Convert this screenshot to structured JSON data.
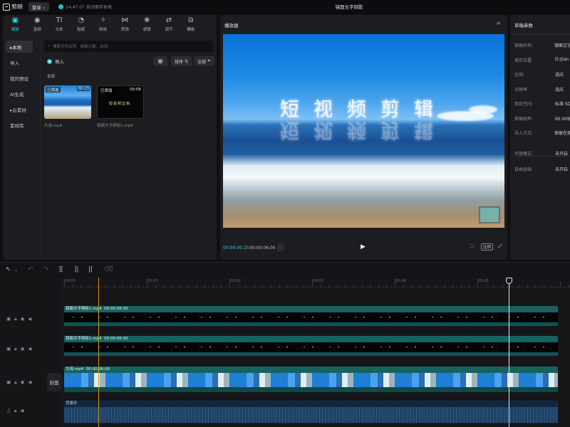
{
  "app": {
    "name": "剪映",
    "menu_label": "菜单",
    "save_status": "14:47:07 自动保存本地",
    "project_title": "镜面文字倒影"
  },
  "toolbar": {
    "tabs": [
      {
        "label": "媒体",
        "icon": "media-icon",
        "glyph": "▣"
      },
      {
        "label": "音频",
        "icon": "audio-icon",
        "glyph": "◉"
      },
      {
        "label": "文本",
        "icon": "text-icon",
        "glyph": "TI"
      },
      {
        "label": "贴纸",
        "icon": "sticker-icon",
        "glyph": "◔"
      },
      {
        "label": "特效",
        "icon": "effects-icon",
        "glyph": "✧"
      },
      {
        "label": "转场",
        "icon": "transition-icon",
        "glyph": "⋈"
      },
      {
        "label": "滤镜",
        "icon": "filter-icon",
        "glyph": "❀"
      },
      {
        "label": "调节",
        "icon": "adjust-icon",
        "glyph": "⇄"
      },
      {
        "label": "模板",
        "icon": "template-icon",
        "glyph": "⧉"
      }
    ]
  },
  "sidebar": {
    "items": [
      {
        "label": "▸本地"
      },
      {
        "label": "导入"
      },
      {
        "label": "我的预设"
      },
      {
        "label": "AI生成"
      },
      {
        "label": "▸云素材"
      },
      {
        "label": "素材库"
      }
    ]
  },
  "media_panel": {
    "search_placeholder": "搜索文件名称、画面元素、台词",
    "import_label": "导入",
    "sort_label": "排序",
    "filter_label": "全部",
    "all_label": "全部",
    "items": [
      {
        "name": "大海.mp4",
        "badge": "已添加",
        "duration": "00:23"
      },
      {
        "name": "镜面文字倒影1.mp4",
        "badge": "已添加",
        "duration": "00:06"
      }
    ],
    "dark_thumb_text": "短视频剪辑"
  },
  "player": {
    "title": "播放器",
    "overlay_text": "短视频剪辑",
    "time_current": "00:00:00:25",
    "time_total": "00:00:06:00",
    "ratio_label": "比例"
  },
  "params": {
    "title": "草稿参数",
    "rows": [
      {
        "k": "草稿名称:",
        "v": "镜面文字"
      },
      {
        "k": "保存位置:",
        "v": "D:/Jian"
      },
      {
        "k": "比例:",
        "v": "适应"
      },
      {
        "k": "分辨率:",
        "v": "适应"
      },
      {
        "k": "色彩空间:",
        "v": "标准 SD"
      },
      {
        "k": "草稿帧率:",
        "v": "60.00帧"
      },
      {
        "k": "导入方式:",
        "v": "保留在原"
      }
    ],
    "rows2": [
      {
        "k": "代理模式:",
        "v": "未开启"
      },
      {
        "k": "自由层级:",
        "v": "未开启"
      }
    ]
  },
  "timeline": {
    "ruler": [
      "00:00",
      "00:01",
      "00:02",
      "00:03",
      "00:04",
      "00:05"
    ],
    "cover_label": "封面",
    "clips": {
      "text1": {
        "name": "镜面文字倒影1.mp4",
        "duration": "00:00:06:00"
      },
      "text2": {
        "name": "镜面文字倒影1.mp4",
        "duration": "00:00:06:00"
      },
      "video": {
        "name": "大海.mp4",
        "duration": "00:00:06:00"
      },
      "audio": {
        "name": "背景乐"
      }
    }
  },
  "colors": {
    "accent": "#19c2c9",
    "bg": "#101012",
    "panel": "#1d1d21",
    "marker": "#d89a10"
  }
}
